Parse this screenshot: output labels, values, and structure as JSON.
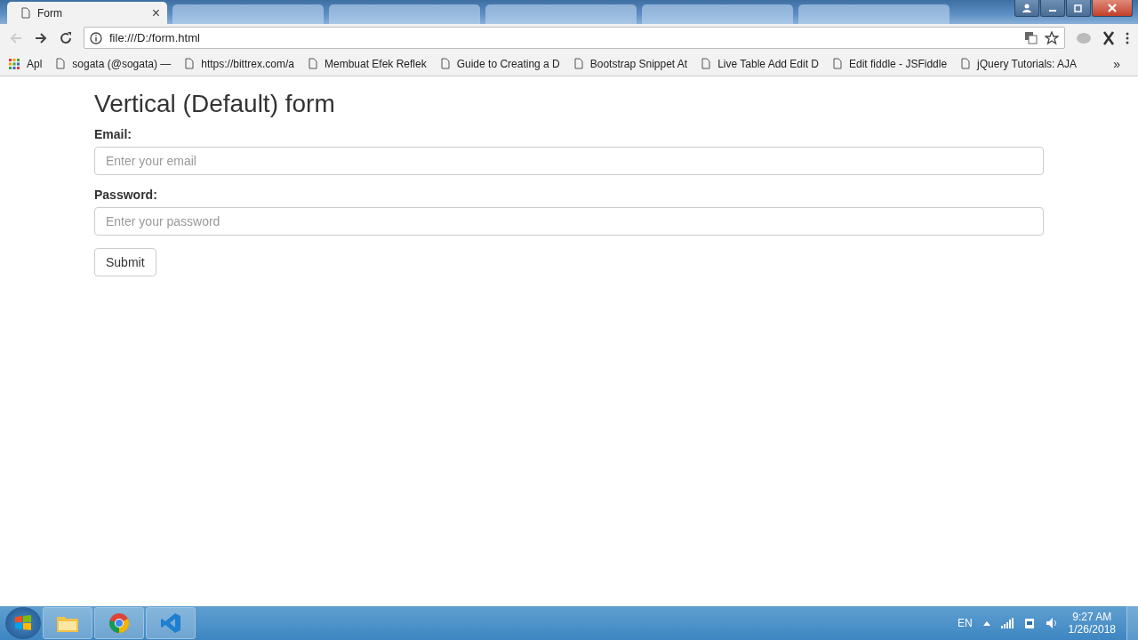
{
  "browser": {
    "active_tab": {
      "title": "Form",
      "close": "×"
    },
    "url": "file:///D:/form.html"
  },
  "bookmarks": {
    "apps": "Apl",
    "items": [
      "sogata (@sogata) —",
      "https://bittrex.com/a",
      "Membuat Efek Reflek",
      "Guide to Creating a D",
      "Bootstrap Snippet At",
      "Live Table Add Edit D",
      "Edit fiddle - JSFiddle",
      "jQuery Tutorials: AJA"
    ],
    "more": "»"
  },
  "page": {
    "heading": "Vertical (Default) form",
    "fields": [
      {
        "label": "Email:",
        "placeholder": "Enter your email"
      },
      {
        "label": "Password:",
        "placeholder": "Enter your password"
      }
    ],
    "submit": "Submit"
  },
  "taskbar": {
    "language": "EN",
    "time": "9:27 AM",
    "date": "1/26/2018"
  }
}
